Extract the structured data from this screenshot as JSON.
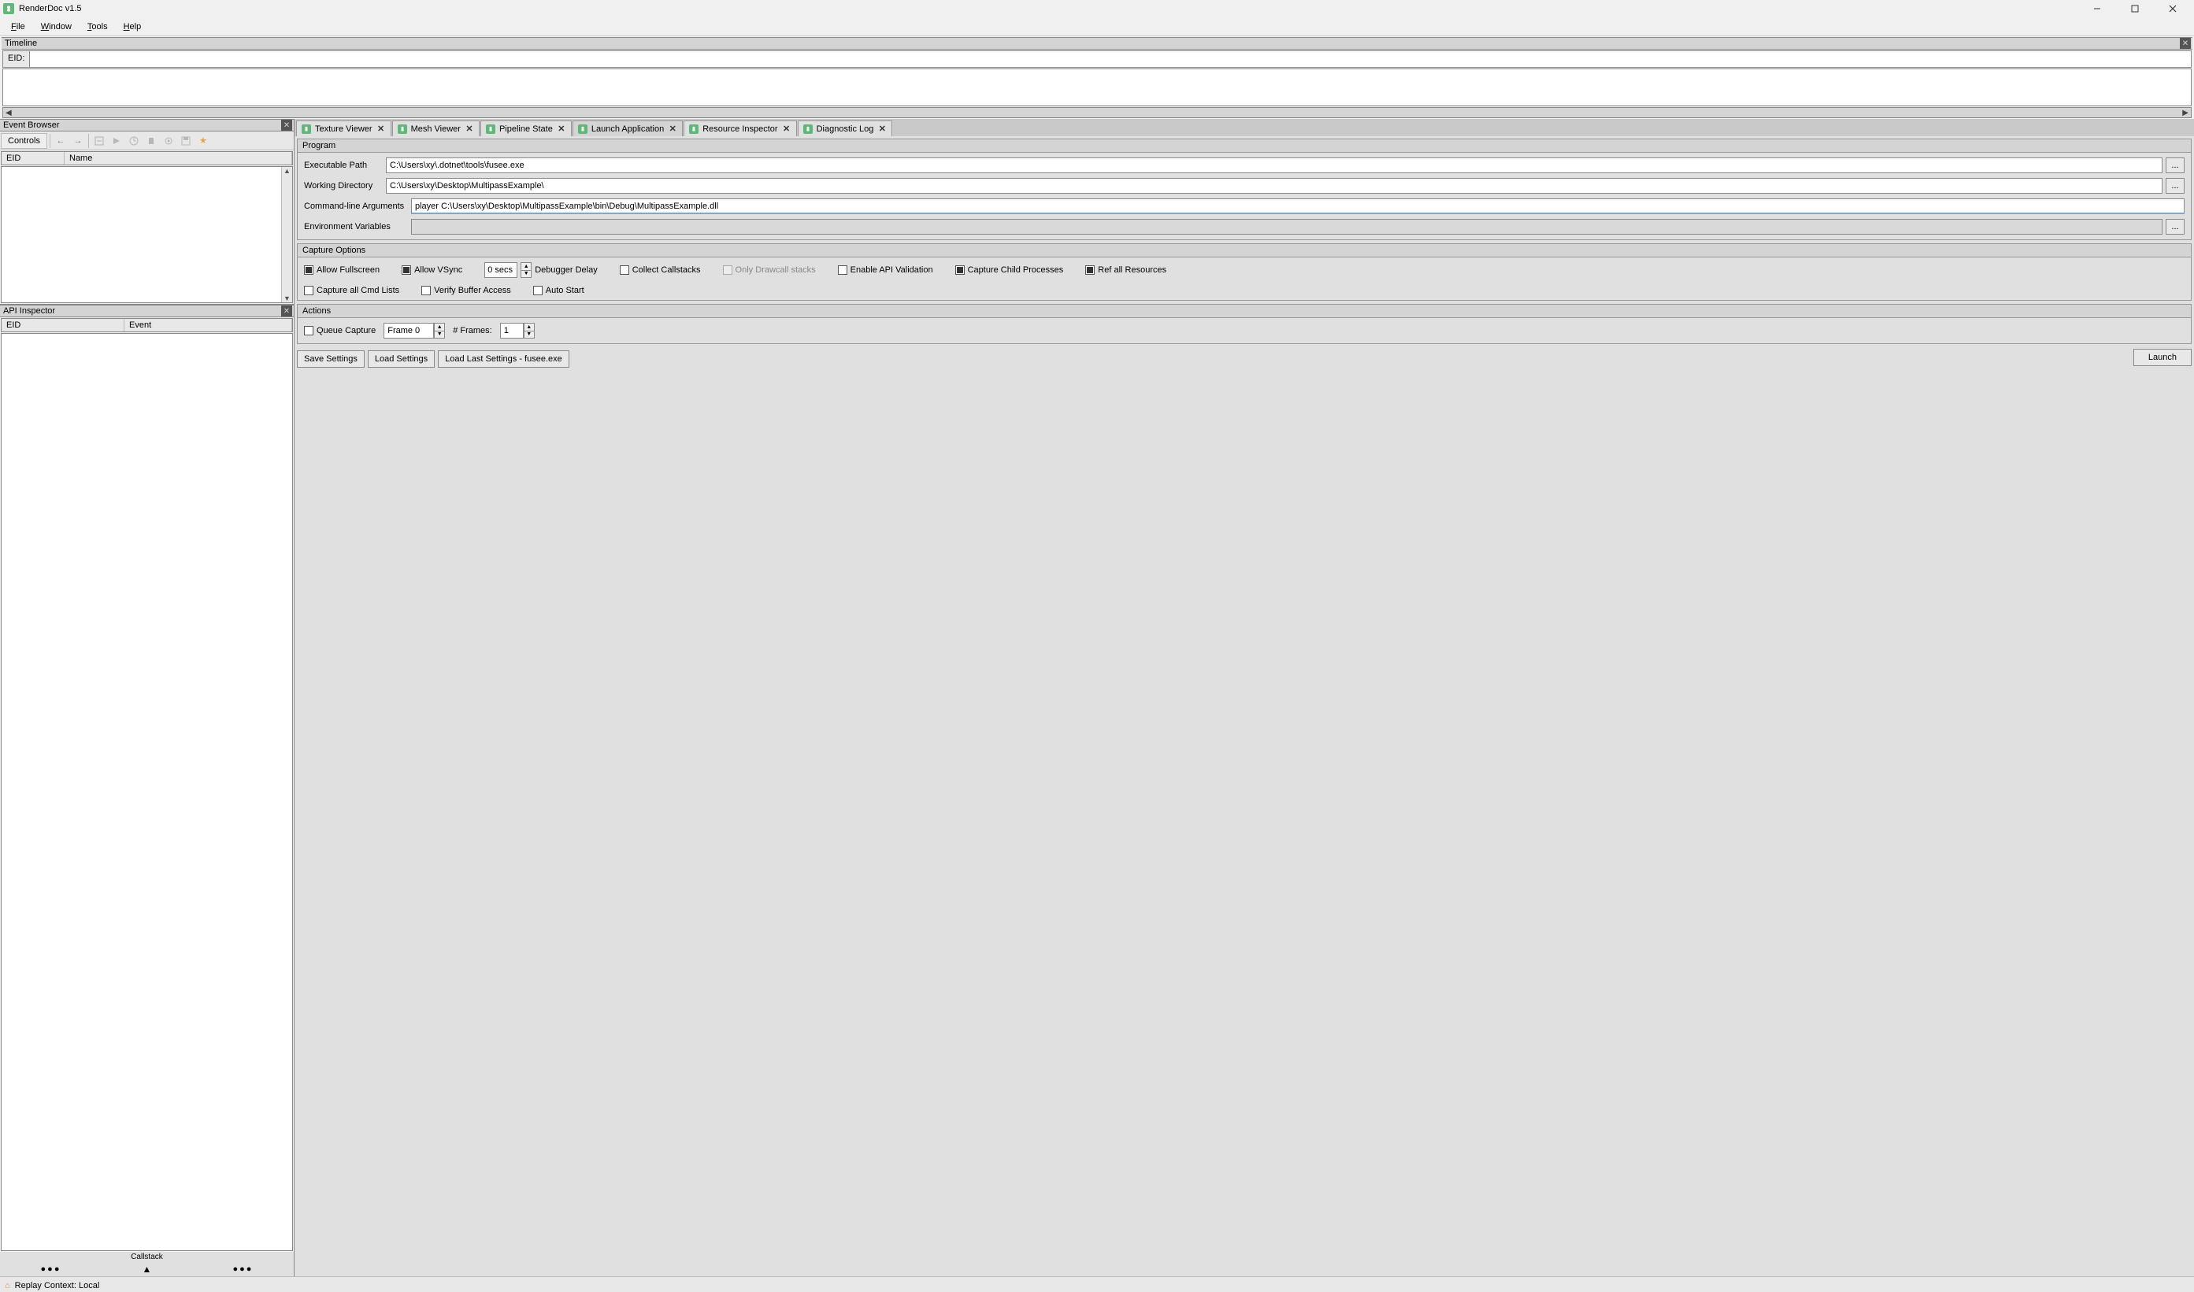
{
  "window": {
    "title": "RenderDoc v1.5"
  },
  "menu": {
    "file": "File",
    "window": "Window",
    "tools": "Tools",
    "help": "Help"
  },
  "timeline": {
    "title": "Timeline",
    "eid_label": "EID:",
    "eid_value": ""
  },
  "event_browser": {
    "title": "Event Browser",
    "controls": "Controls",
    "columns": {
      "eid": "EID",
      "name": "Name"
    }
  },
  "api_inspector": {
    "title": "API Inspector",
    "columns": {
      "eid": "EID",
      "event": "Event"
    },
    "callstack": "Callstack"
  },
  "tabs": [
    {
      "label": "Texture Viewer"
    },
    {
      "label": "Mesh Viewer"
    },
    {
      "label": "Pipeline State"
    },
    {
      "label": "Launch Application",
      "active": true
    },
    {
      "label": "Resource Inspector"
    },
    {
      "label": "Diagnostic Log"
    }
  ],
  "program": {
    "group_title": "Program",
    "exe_label": "Executable Path",
    "exe_value": "C:\\Users\\xy\\.dotnet\\tools\\fusee.exe",
    "wd_label": "Working Directory",
    "wd_value": "C:\\Users\\xy\\Desktop\\MultipassExample\\",
    "args_label": "Command-line Arguments",
    "args_value": "player C:\\Users\\xy\\Desktop\\MultipassExample\\bin\\Debug\\MultipassExample.dll",
    "env_label": "Environment Variables",
    "env_value": ""
  },
  "capture": {
    "group_title": "Capture Options",
    "allow_fullscreen": "Allow Fullscreen",
    "allow_vsync": "Allow VSync",
    "debugger_delay_value": "0 secs",
    "debugger_delay_label": "Debugger Delay",
    "collect_callstacks": "Collect Callstacks",
    "only_drawcall_stacks": "Only Drawcall stacks",
    "enable_api_validation": "Enable API Validation",
    "capture_child_processes": "Capture Child Processes",
    "ref_all_resources": "Ref all Resources",
    "capture_all_cmd_lists": "Capture all Cmd Lists",
    "verify_buffer_access": "Verify Buffer Access",
    "auto_start": "Auto Start"
  },
  "actions": {
    "group_title": "Actions",
    "queue_capture": "Queue Capture",
    "queue_value": "Frame 0",
    "num_frames_label": "# Frames:",
    "num_frames_value": "1"
  },
  "buttons": {
    "save_settings": "Save Settings",
    "load_settings": "Load Settings",
    "load_last": "Load Last Settings - fusee.exe",
    "launch": "Launch",
    "browse": "..."
  },
  "statusbar": {
    "replay_context": "Replay Context: Local"
  }
}
